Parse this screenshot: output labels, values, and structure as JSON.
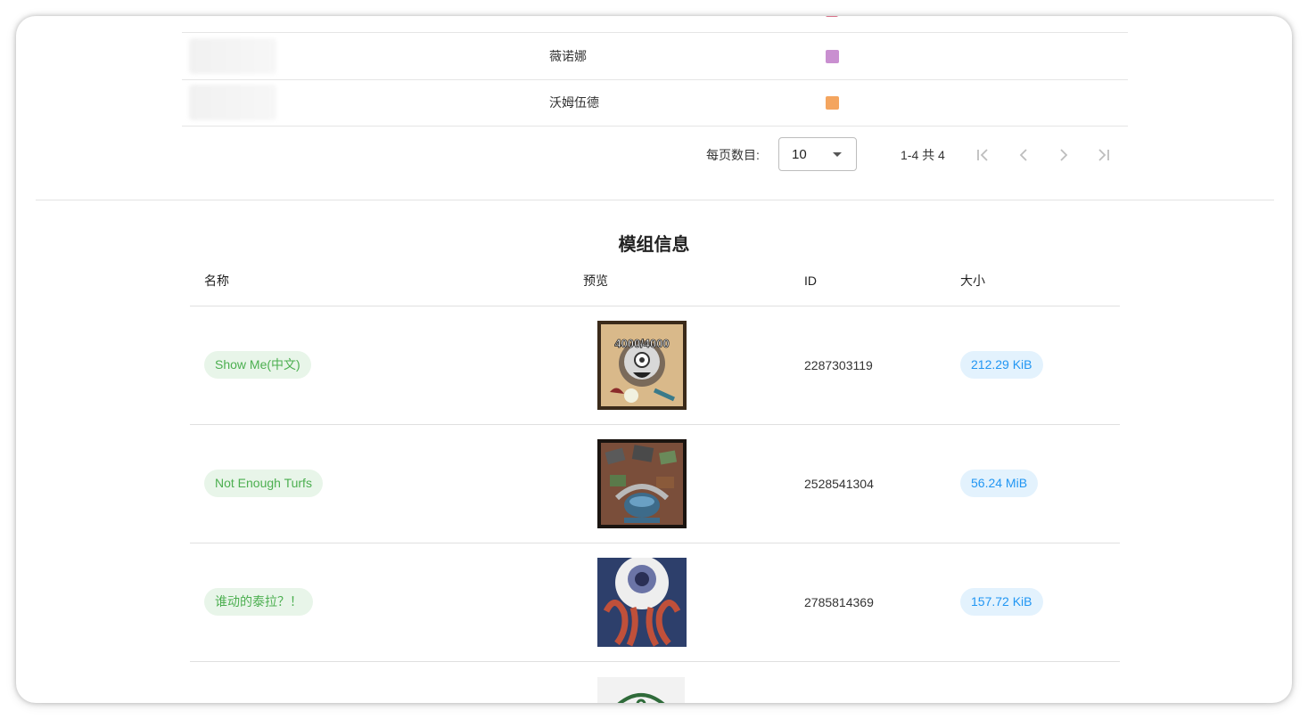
{
  "players": {
    "top_partial_color": "#d9738a",
    "rows": [
      {
        "role": "薇诺娜",
        "color": "#c98fd0"
      },
      {
        "role": "沃姆伍德",
        "color": "#f4a55f"
      }
    ]
  },
  "pagination": {
    "rows_per_page_label": "每页数目:",
    "rows_per_page_value": "10",
    "range_text": "1-4 共 4",
    "icons": [
      "first-page-icon",
      "prev-page-icon",
      "next-page-icon",
      "last-page-icon"
    ]
  },
  "mods": {
    "title": "模组信息",
    "headers": {
      "name": "名称",
      "preview": "预览",
      "id": "ID",
      "size": "大小"
    },
    "rows": [
      {
        "name": "Show Me(中文)",
        "preview_text": "4000/4000",
        "id": "2287303119",
        "size": "212.29 KiB"
      },
      {
        "name": "Not Enough Turfs",
        "preview_text": "",
        "id": "2528541304",
        "size": "56.24 MiB"
      },
      {
        "name": "谁动的泰拉？！",
        "preview_text": "",
        "id": "2785814369",
        "size": "157.72 KiB"
      }
    ]
  },
  "colors": {
    "name_chip_bg": "#e8f5e9",
    "name_chip_fg": "#4caf50",
    "size_chip_bg": "#e3f2fd",
    "size_chip_fg": "#2196f3"
  }
}
